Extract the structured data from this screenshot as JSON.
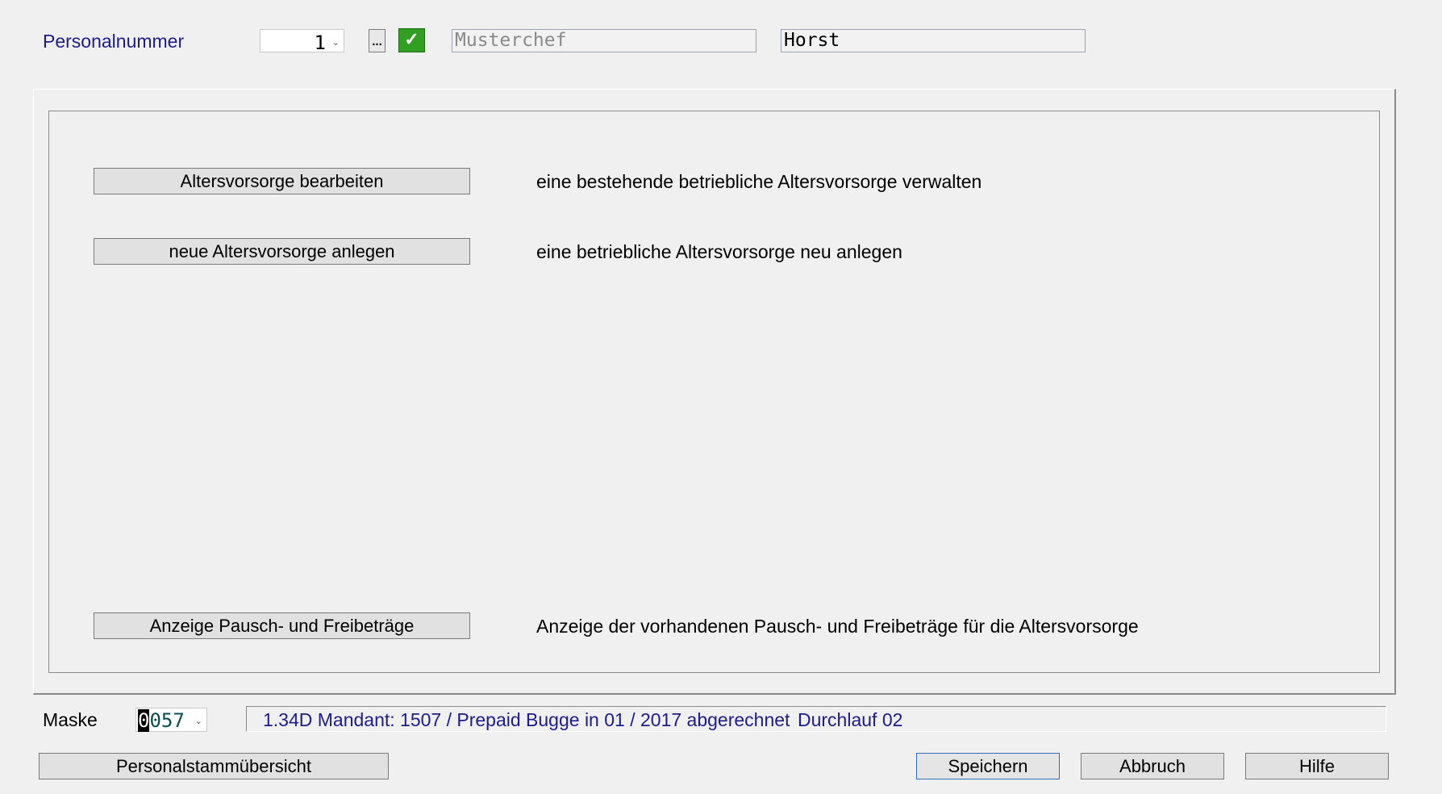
{
  "header": {
    "personalnummer_label": "Personalnummer",
    "personalnummer_value": "1",
    "lookup_label": "...",
    "confirm_icon": "check-icon",
    "nachname": "Musterchef",
    "vorname": "Horst"
  },
  "actions": [
    {
      "button": "Altersvorsorge bearbeiten",
      "description": "eine bestehende betriebliche Altersvorsorge verwalten"
    },
    {
      "button": "neue Altersvorsorge anlegen",
      "description": "eine betriebliche Altersvorsorge neu anlegen"
    },
    {
      "button": "Anzeige Pausch- und Freibeträge",
      "description": "Anzeige der vorhandenen Pausch- und Freibeträge für die Altersvorsorge"
    }
  ],
  "footer": {
    "maske_label": "Maske",
    "maske_cursor_char": "0",
    "maske_rest": "057",
    "status_text": "1.34D Mandant: 1507 / Prepaid Bugge in 01 / 2017 abgerechnet",
    "durchlauf": "Durchlauf 02",
    "overview_button": "Personalstammübersicht",
    "save_button": "Speichern",
    "cancel_button": "Abbruch",
    "help_button": "Hilfe"
  },
  "colors": {
    "accent_text": "#1c1c8c",
    "confirm_green": "#31a022",
    "focus_border": "#2c6fba"
  }
}
